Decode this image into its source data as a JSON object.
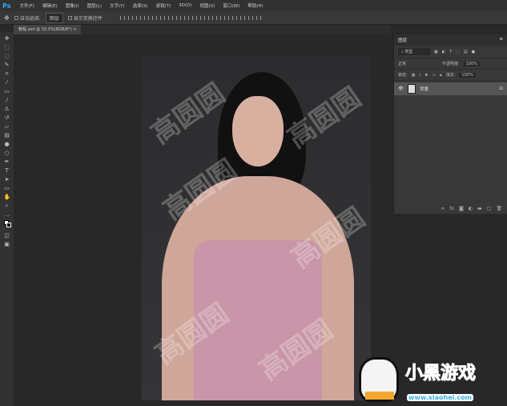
{
  "app": {
    "logo": "Ps"
  },
  "menu": [
    "文件(F)",
    "编辑(E)",
    "图像(I)",
    "图层(L)",
    "文字(Y)",
    "选择(S)",
    "滤镜(T)",
    "3D(D)",
    "视图(V)",
    "窗口(W)",
    "帮助(H)"
  ],
  "options": {
    "auto_select_label": "自动选择:",
    "auto_select_value": "图层",
    "show_transform_label": "显示变换控件"
  },
  "document_tab": {
    "title": "教程.psd @ 33.3%(RGB/8*)",
    "close": "×"
  },
  "canvas": {
    "watermark": "高圆圆"
  },
  "layers_panel": {
    "title": "图层",
    "filter_kind": "类型",
    "blend_mode": "正常",
    "opacity_label": "不透明度:",
    "opacity_value": "100%",
    "lock_label": "锁定:",
    "fill_label": "填充:",
    "fill_value": "100%",
    "layers": [
      {
        "name": "背景",
        "visible": true,
        "locked": true
      }
    ]
  },
  "site_logo": {
    "name": "小黑游戏",
    "url": "www.xiaohei.com"
  }
}
